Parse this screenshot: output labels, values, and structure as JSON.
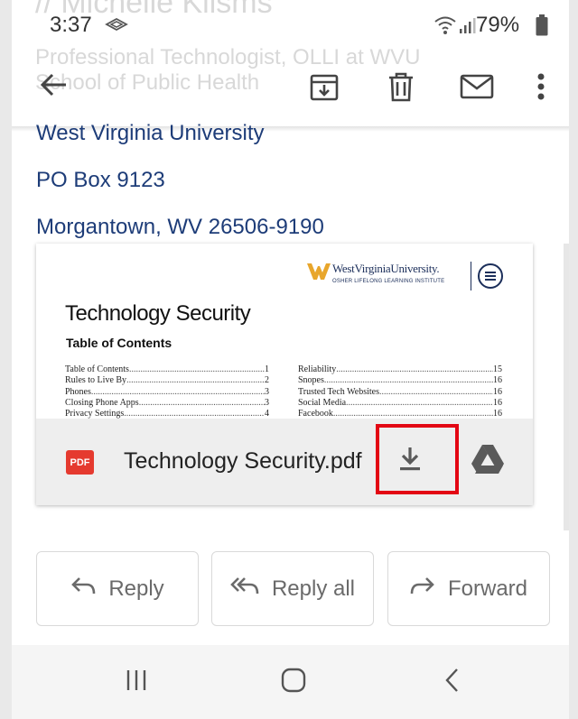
{
  "background_text": {
    "sender_name": "// Michelle Kilsms",
    "line1": "Professional Technologist, OLLI at WVU",
    "line2": "School of Public Health"
  },
  "status_bar": {
    "time": "3:37",
    "battery": "79%"
  },
  "app_bar": {
    "back_icon": "arrow-back-icon",
    "archive_icon": "archive-icon",
    "delete_icon": "trash-icon",
    "mark_unread_icon": "mail-icon",
    "more_icon": "more-vert-icon"
  },
  "message": {
    "address_line1": "West Virginia University",
    "address_line2": "PO Box 9123",
    "address_line3": "Morgantown, WV 26506-9190"
  },
  "attachment": {
    "preview": {
      "logo_name": "WestVirginiaUniversity.",
      "logo_sub": "OSHER LIFELONG LEARNING INSTITUTE",
      "title": "Technology Security",
      "subtitle": "Table of Contents",
      "toc_left": [
        {
          "label": "Table of Contents",
          "page": "1"
        },
        {
          "label": "Rules to Live By",
          "page": "2"
        },
        {
          "label": "Phones",
          "page": "3"
        },
        {
          "label": "Closing Phone Apps",
          "page": "3"
        },
        {
          "label": "Privacy Settings",
          "page": "4"
        }
      ],
      "toc_right": [
        {
          "label": "Reliability",
          "page": "15"
        },
        {
          "label": "Snopes",
          "page": "16"
        },
        {
          "label": "Trusted Tech Websites",
          "page": "16"
        },
        {
          "label": "Social Media",
          "page": "16"
        },
        {
          "label": "Facebook",
          "page": "16"
        }
      ]
    },
    "file_type": "PDF",
    "file_name": "Technology Security.pdf",
    "download_icon": "download-icon",
    "drive_icon": "google-drive-icon"
  },
  "actions": {
    "reply": "Reply",
    "reply_all": "Reply all",
    "forward": "Forward"
  },
  "colors": {
    "link_text": "#1d3c78",
    "pdf_badge": "#e53a2f",
    "highlight": "#e30613"
  }
}
